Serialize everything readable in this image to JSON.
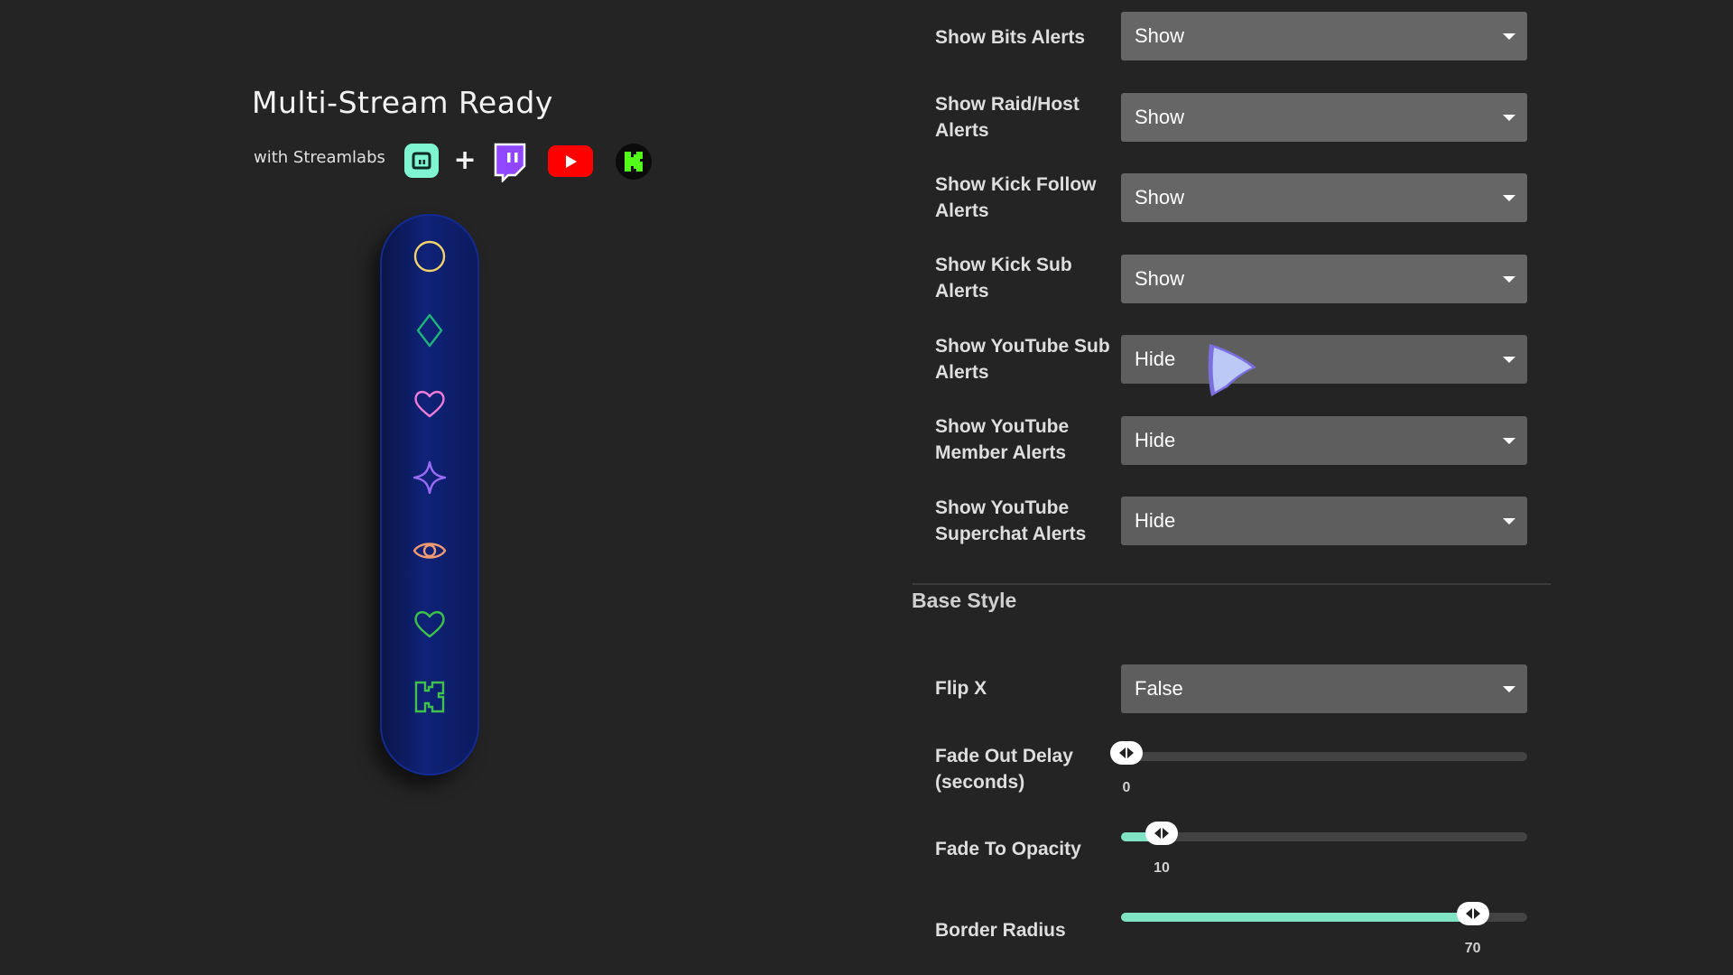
{
  "promo": {
    "title": "Multi-Stream Ready",
    "subtitle": "with Streamlabs",
    "plus": "+",
    "logos": [
      "streamlabs-logo",
      "twitch-logo",
      "youtube-logo",
      "kick-logo"
    ]
  },
  "widget": {
    "icons": [
      "circle-icon",
      "diamond-icon",
      "heart-icon",
      "sparkle-icon",
      "eye-icon",
      "heart-icon",
      "kick-k-icon"
    ],
    "icon_colors": [
      "#f3d36b",
      "#1db37a",
      "#f07bd8",
      "#9a6cf5",
      "#f29a72",
      "#3fc24a",
      "#3fc24a"
    ]
  },
  "settings": {
    "rows": [
      {
        "label": "Show Bits Alerts",
        "value": "Show"
      },
      {
        "label": "Show Raid/Host Alerts",
        "value": "Show"
      },
      {
        "label": "Show Kick Follow Alerts",
        "value": "Show"
      },
      {
        "label": "Show Kick Sub Alerts",
        "value": "Show"
      },
      {
        "label": "Show YouTube Sub Alerts",
        "value": "Hide"
      },
      {
        "label": "Show YouTube Member Alerts",
        "value": "Hide"
      },
      {
        "label": "Show YouTube Superchat Alerts",
        "value": "Hide"
      }
    ]
  },
  "base_style": {
    "title": "Base Style",
    "flip_x": {
      "label": "Flip X",
      "value": "False"
    },
    "sliders": [
      {
        "label": "Fade Out Delay (seconds)",
        "value": "0",
        "fraction": 0.0
      },
      {
        "label": "Fade To Opacity",
        "value": "10",
        "fraction": 0.1
      },
      {
        "label": "Border Radius",
        "value": "70",
        "fraction": 0.866
      }
    ]
  },
  "colors": {
    "accent": "#7fe3c4",
    "panel": "#242424",
    "select": "#666666",
    "widget": "#0f2278"
  }
}
